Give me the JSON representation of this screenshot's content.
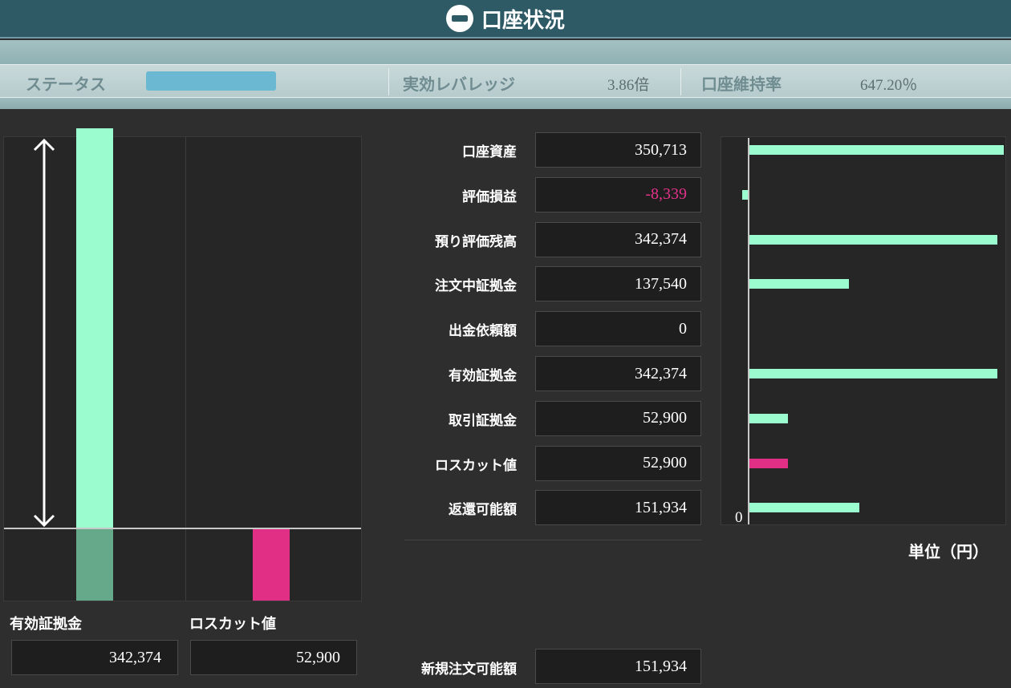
{
  "title": "口座状況",
  "status": {
    "status_label": "ステータス",
    "leverage_label": "実効レバレッジ",
    "leverage_value": "3.86倍",
    "maintenance_label": "口座維持率",
    "maintenance_value": "647.20％",
    "status_color": "#6ab8d2"
  },
  "rows": [
    {
      "label": "口座資産",
      "value": "350,713",
      "amount": 350713
    },
    {
      "label": "評価損益",
      "value": "-8,339",
      "amount": -8339
    },
    {
      "label": "預り評価残高",
      "value": "342,374",
      "amount": 342374
    },
    {
      "label": "注文中証拠金",
      "value": "137,540",
      "amount": 137540
    },
    {
      "label": "出金依頼額",
      "value": "0",
      "amount": 0
    },
    {
      "label": "有効証拠金",
      "value": "342,374",
      "amount": 342374
    },
    {
      "label": "取引証拠金",
      "value": "52,900",
      "amount": 52900
    },
    {
      "label": "ロスカット値",
      "value": "52,900",
      "amount": 52900
    },
    {
      "label": "返還可能額",
      "value": "151,934",
      "amount": 151934
    }
  ],
  "new_order": {
    "label": "新規注文可能額",
    "value": "151,934"
  },
  "left_chart": {
    "effective_margin_label": "有効証拠金",
    "effective_margin_value": "342,374",
    "loss_cut_label": "ロスカット値",
    "loss_cut_value": "52,900"
  },
  "chart_data": {
    "type": "bar",
    "orientation": "horizontal",
    "categories": [
      "口座資産",
      "評価損益",
      "預り評価残高",
      "注文中証拠金",
      "出金依頼額",
      "有効証拠金",
      "取引証拠金",
      "ロスカット値",
      "返還可能額"
    ],
    "values": [
      350713,
      -8339,
      342374,
      137540,
      0,
      342374,
      52900,
      52900,
      151934
    ],
    "colors": [
      "#9bfcd0",
      "#9bfcd0",
      "#9bfcd0",
      "#9bfcd0",
      "#9bfcd0",
      "#9bfcd0",
      "#9bfcd0",
      "#e02f84",
      "#9bfcd0"
    ],
    "zero_label": "0",
    "unit_label": "単位（円）"
  },
  "colors": {
    "positive": "#9bfcd0",
    "negative": "#e02f84",
    "header": "#2e5a66"
  }
}
